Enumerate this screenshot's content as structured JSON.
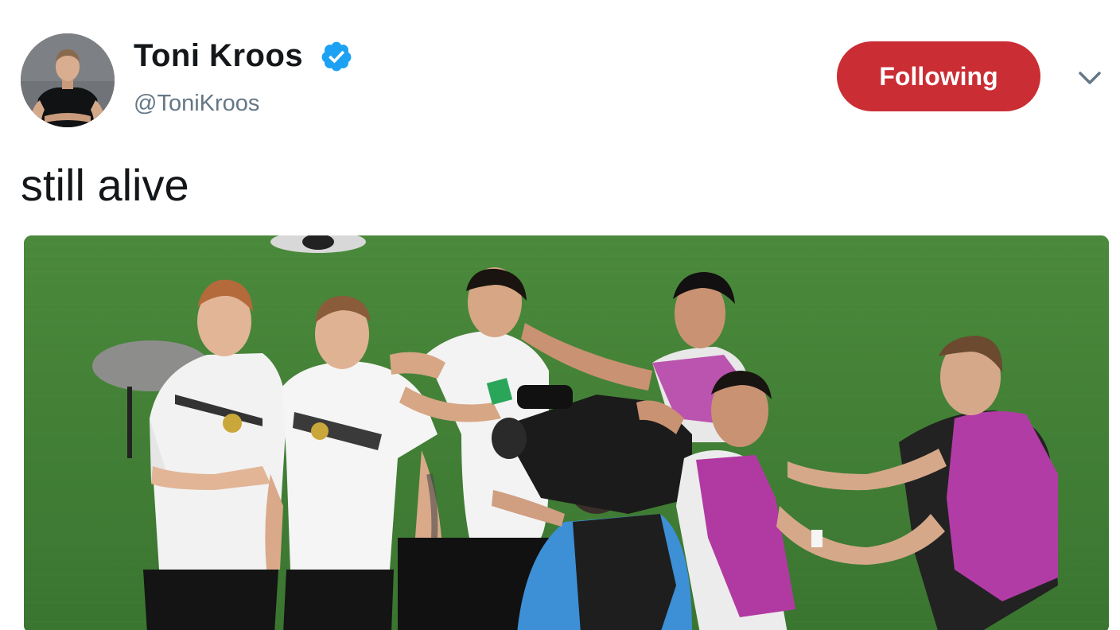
{
  "author": {
    "display_name": "Toni Kroos",
    "handle": "@ToniKroos",
    "verified": true,
    "verified_icon": "verified-badge-icon",
    "avatar_icon": "profile-photo"
  },
  "follow_button": {
    "label": "Following",
    "color": "#cb2d34"
  },
  "menu": {
    "icon": "chevron-down-icon"
  },
  "tweet": {
    "text": "still alive"
  },
  "media": {
    "type": "photo",
    "subject": "football-celebration"
  },
  "colors": {
    "text_primary": "#14171a",
    "text_secondary": "#657786",
    "verified_blue": "#1da1f2",
    "pitch_green": "#3a7a32"
  }
}
